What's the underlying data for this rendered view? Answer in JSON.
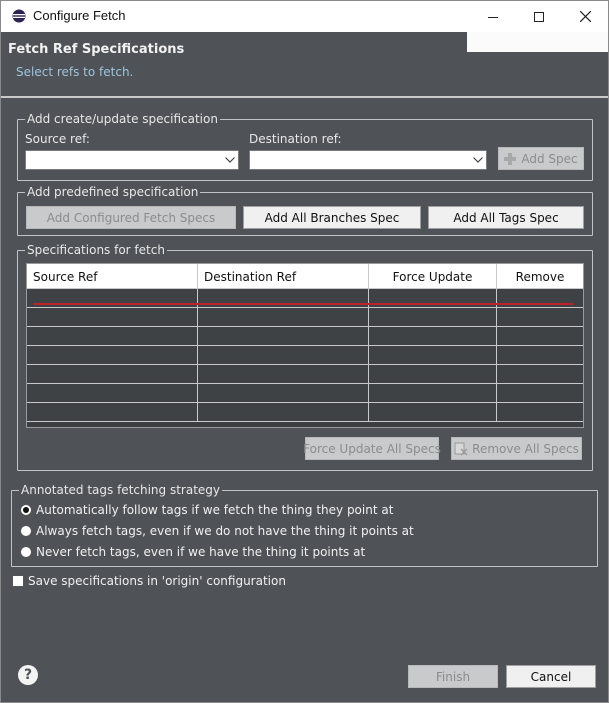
{
  "window": {
    "title": "Configure Fetch",
    "icons": {
      "app": "eclipse-icon",
      "minimize": "minimize-icon",
      "maximize": "maximize-icon",
      "close": "close-icon"
    }
  },
  "header": {
    "title": "Fetch Ref Specifications",
    "description": "Select refs to fetch."
  },
  "create_group": {
    "label": "Add create/update specification",
    "source_label": "Source ref:",
    "destination_label": "Destination ref:",
    "source_value": "",
    "destination_value": "",
    "add_spec": "Add Spec"
  },
  "predefined_group": {
    "label": "Add predefined specification",
    "add_configured": "Add Configured Fetch Specs",
    "add_all_branches": "Add All Branches Spec",
    "add_all_tags": "Add All Tags Spec"
  },
  "specs_group": {
    "label": "Specifications for fetch",
    "columns": [
      "Source Ref",
      "Destination Ref",
      "Force Update",
      "Remove"
    ],
    "row_count": 7,
    "force_update_all": "Force Update All Specs",
    "remove_all": "Remove All Specs"
  },
  "tags_group": {
    "label": "Annotated tags fetching strategy",
    "options": [
      {
        "label": "Automatically follow tags if we fetch the thing they point at",
        "checked": true
      },
      {
        "label": "Always fetch tags, even if we do not have the thing it points at",
        "checked": false
      },
      {
        "label": "Never fetch tags, even if we have the thing it points at",
        "checked": false
      }
    ]
  },
  "save_config": {
    "label": "Save specifications in 'origin' configuration",
    "checked": false
  },
  "footer": {
    "finish": "Finish",
    "cancel": "Cancel",
    "help_icon": "help-icon"
  },
  "colors": {
    "background": "#4f5357",
    "accent_red": "#c12228",
    "description": "#9ec3dc"
  }
}
